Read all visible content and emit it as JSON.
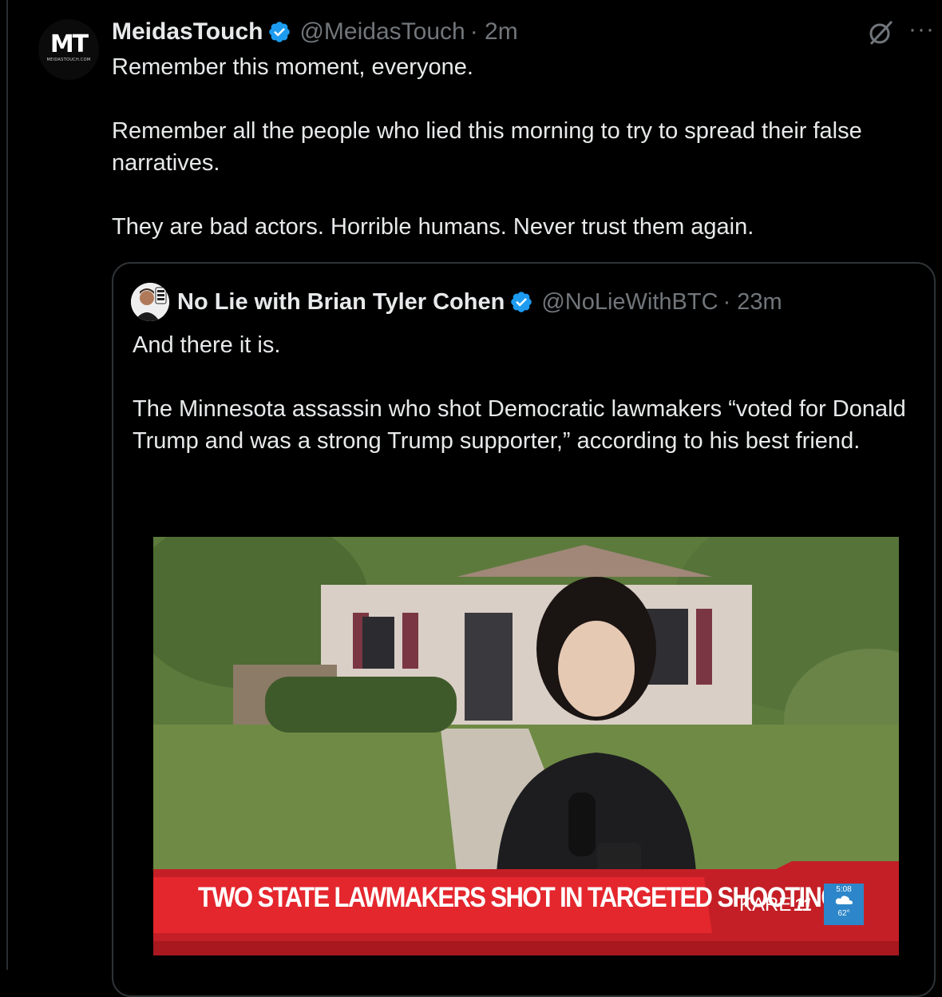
{
  "tweet": {
    "author_name": "MeidasTouch",
    "handle": "@MeidasTouch",
    "time": "· 2m",
    "avatar_text": "MT",
    "avatar_subtext": "MEIDASTOUCH.COM",
    "paragraphs": [
      "Remember this moment, everyone.",
      "Remember all the people who lied this morning to try to spread their false narratives.",
      "They are bad actors. Horrible humans. Never trust them again."
    ],
    "more_label": "···",
    "icons": {
      "verified": "verified-badge-icon",
      "grok": "grok-icon",
      "more": "more-icon"
    }
  },
  "quoted_tweet": {
    "author_name": "No Lie with Brian Tyler Cohen",
    "handle": "@NoLieWithBTC",
    "time": "· 23m",
    "paragraphs": [
      "And there it is.",
      "The Minnesota assassin who shot Democratic lawmakers “voted for Donald Trump and was a strong Trump supporter,” according to his best friend."
    ],
    "media": {
      "lower_third": "TWO STATE LAWMAKERS SHOT IN TARGETED SHOOTINGS",
      "station": "KARE",
      "station_number": "11",
      "weather_time": "5:08",
      "weather_temp": "62°"
    }
  },
  "colors": {
    "background": "#000000",
    "text": "#e7e9ea",
    "muted": "#71767b",
    "verified": "#1d9bf0",
    "border": "#2f3336",
    "ticker_red": "#d7262b"
  }
}
